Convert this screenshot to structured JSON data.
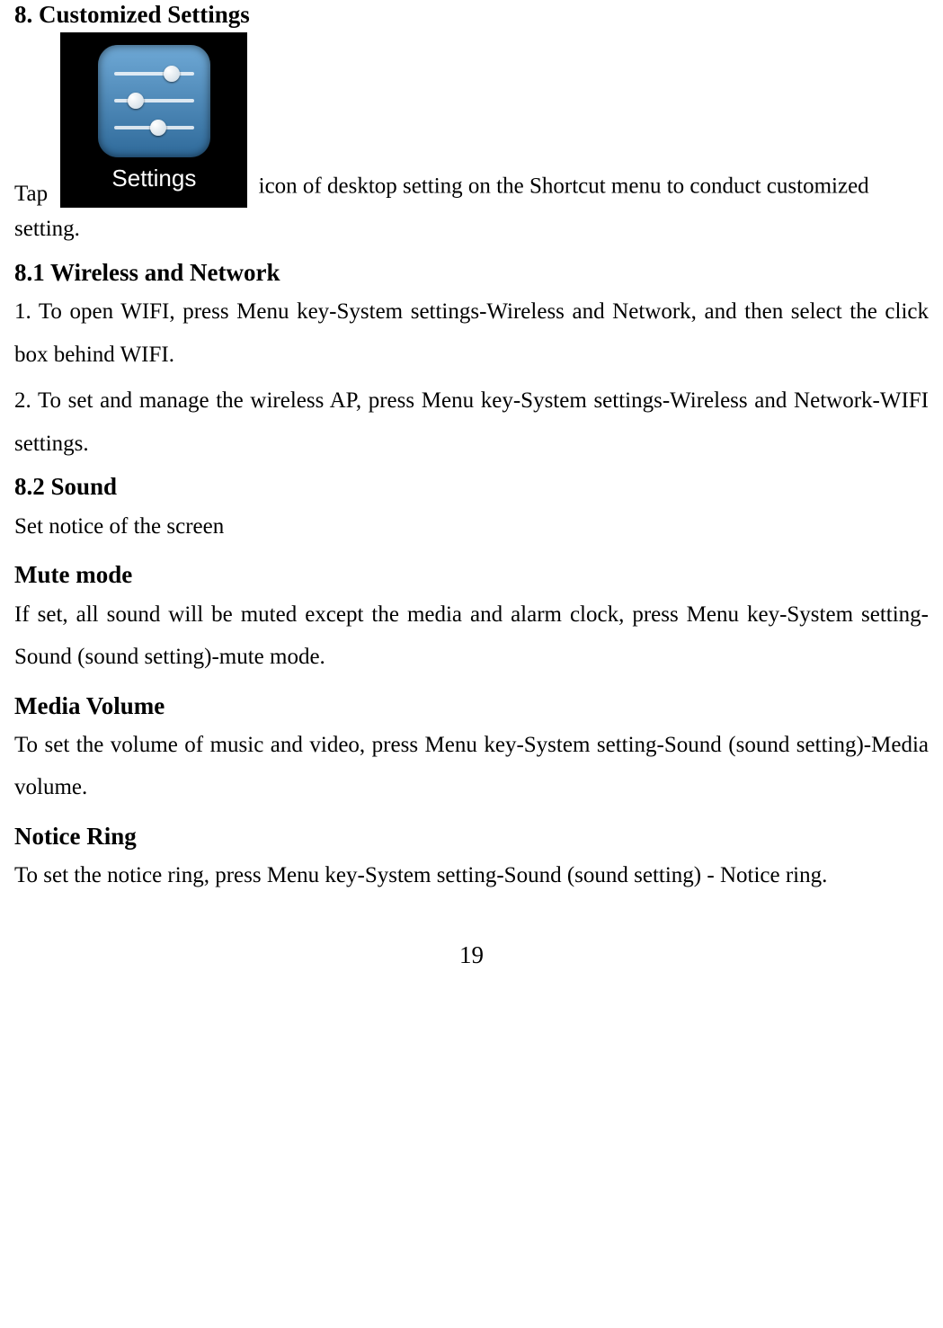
{
  "headings": {
    "h8": "8. Customized Settings",
    "h8_1": "8.1 Wireless and Network",
    "h8_2": "8.2 Sound",
    "mute": "Mute mode",
    "media": "Media Volume",
    "notice": "Notice Ring"
  },
  "icon": {
    "caption": "Settings"
  },
  "text": {
    "tap_prefix": "Tap",
    "tap_suffix": "  icon of desktop setting on the Shortcut menu to conduct customized setting.",
    "wifi1": "1. To open WIFI, press Menu key-System settings-Wireless and Network, and then select the click box behind WIFI.",
    "wifi2": "2. To set and manage the wireless AP, press Menu key-System settings-Wireless and Network-WIFI settings.",
    "sound_intro": "Set notice of the screen",
    "mute_body": "If set, all sound will be muted except the media and alarm clock, press Menu key-System setting-Sound (sound setting)-mute mode.",
    "media_body": "To set the volume of music and video, press Menu key-System setting-Sound (sound setting)-Media volume.",
    "notice_body": "To set the notice ring, press Menu key-System setting-Sound (sound setting) - Notice ring."
  },
  "page_number": "19"
}
